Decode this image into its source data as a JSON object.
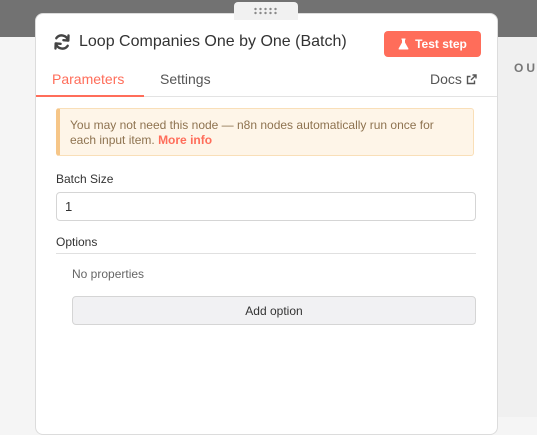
{
  "node": {
    "title": "Loop Companies One by One (Batch)",
    "icon": "refresh-icon"
  },
  "toolbar": {
    "test_step_label": "Test step",
    "test_step_icon": "flask-icon"
  },
  "tabs": [
    {
      "label": "Parameters",
      "active": true
    },
    {
      "label": "Settings",
      "active": false
    }
  ],
  "docs": {
    "label": "Docs",
    "icon": "external-link-icon"
  },
  "side_panel": {
    "label": "OU"
  },
  "notice": {
    "text": "You may not need this node — n8n nodes automatically run once for each input item.",
    "link": "More info"
  },
  "fields": {
    "batch_size": {
      "label": "Batch Size",
      "value": "1"
    }
  },
  "options": {
    "label": "Options",
    "empty_text": "No properties",
    "add_label": "Add option"
  },
  "colors": {
    "accent": "#ff6d5a",
    "notice_bg": "#fef5e8",
    "notice_border": "#f6c688"
  }
}
